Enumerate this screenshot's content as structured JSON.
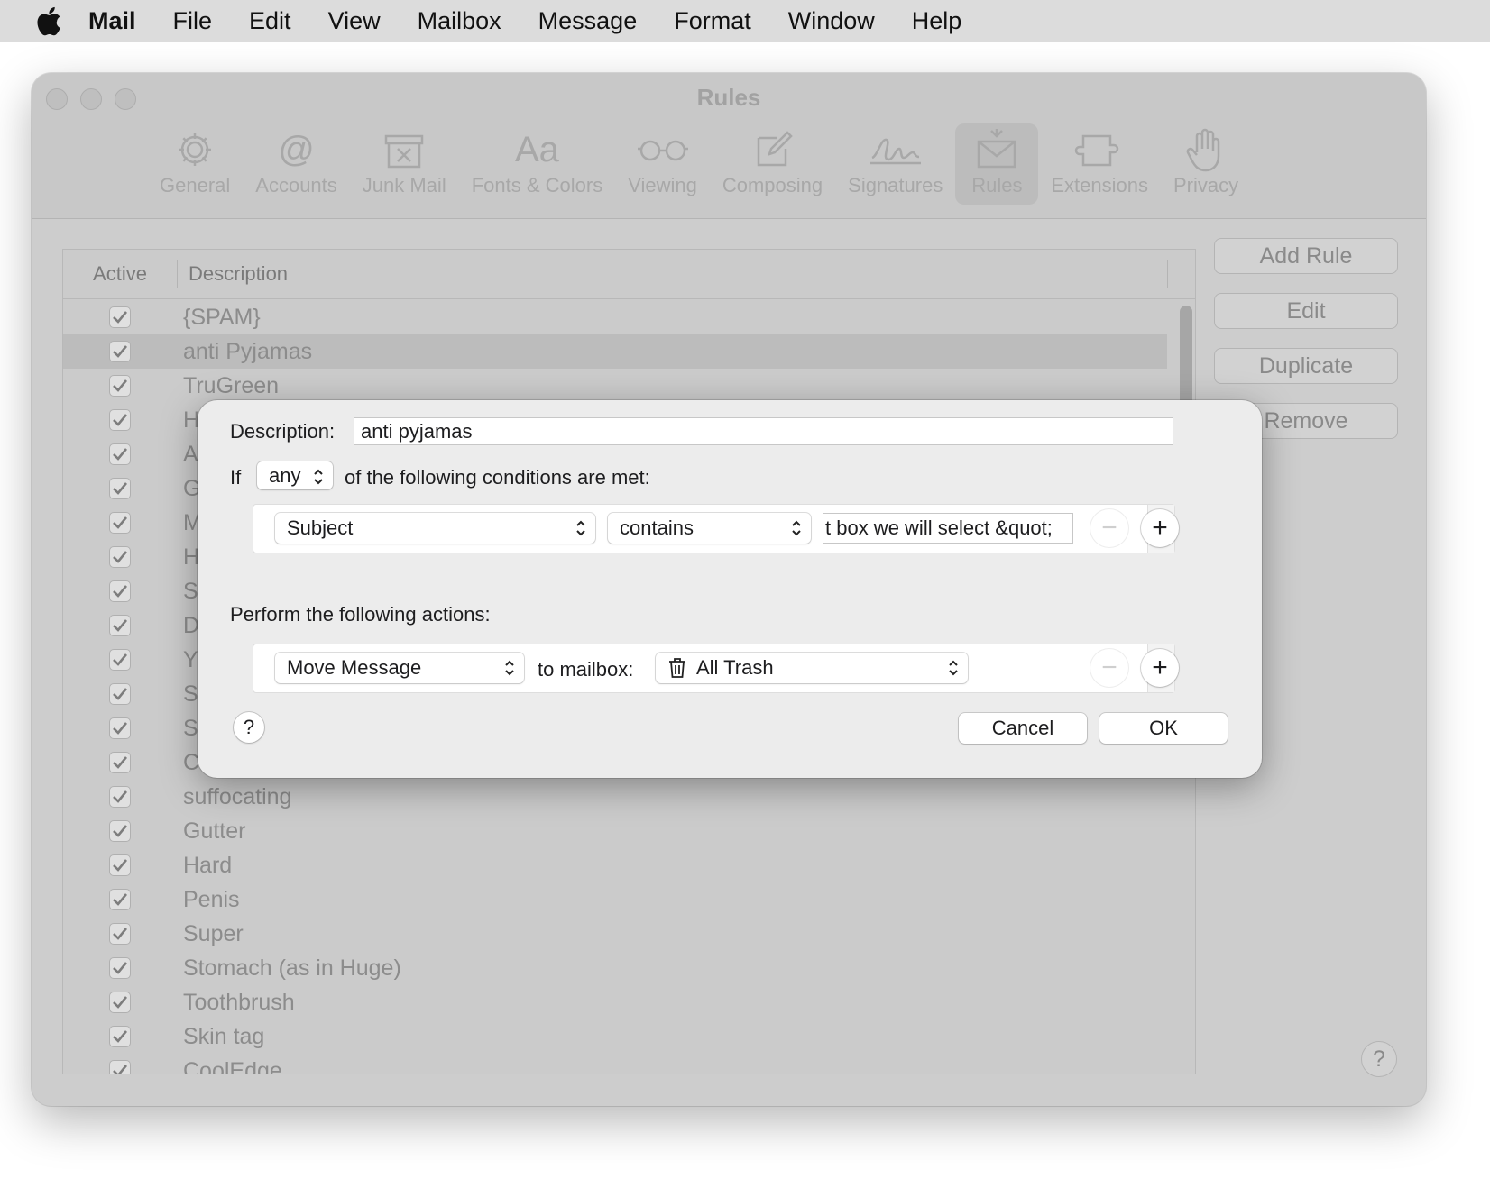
{
  "menubar": {
    "app_name": "Mail",
    "items": [
      "File",
      "Edit",
      "View",
      "Mailbox",
      "Message",
      "Format",
      "Window",
      "Help"
    ]
  },
  "window": {
    "title": "Rules",
    "toolbar": [
      {
        "label": "General",
        "icon": "gear-icon"
      },
      {
        "label": "Accounts",
        "icon": "at-icon"
      },
      {
        "label": "Junk Mail",
        "icon": "junk-mail-icon"
      },
      {
        "label": "Fonts & Colors",
        "icon": "fonts-icon"
      },
      {
        "label": "Viewing",
        "icon": "glasses-icon"
      },
      {
        "label": "Composing",
        "icon": "compose-icon"
      },
      {
        "label": "Signatures",
        "icon": "signature-icon"
      },
      {
        "label": "Rules",
        "icon": "rules-icon",
        "active": true
      },
      {
        "label": "Extensions",
        "icon": "extensions-icon"
      },
      {
        "label": "Privacy",
        "icon": "hand-icon"
      }
    ]
  },
  "rules_table": {
    "headers": {
      "active": "Active",
      "description": "Description"
    },
    "rows": [
      {
        "active": true,
        "description": "{SPAM}"
      },
      {
        "active": true,
        "description": "anti Pyjamas",
        "selected": true
      },
      {
        "active": true,
        "description": "TruGreen"
      },
      {
        "active": true,
        "description": "H"
      },
      {
        "active": true,
        "description": "A"
      },
      {
        "active": true,
        "description": "G"
      },
      {
        "active": true,
        "description": "M"
      },
      {
        "active": true,
        "description": "H"
      },
      {
        "active": true,
        "description": "S"
      },
      {
        "active": true,
        "description": "D"
      },
      {
        "active": true,
        "description": "Y"
      },
      {
        "active": true,
        "description": "S"
      },
      {
        "active": true,
        "description": "S"
      },
      {
        "active": true,
        "description": "C"
      },
      {
        "active": true,
        "description": "suffocating"
      },
      {
        "active": true,
        "description": "Gutter"
      },
      {
        "active": true,
        "description": "Hard"
      },
      {
        "active": true,
        "description": "Penis"
      },
      {
        "active": true,
        "description": "Super"
      },
      {
        "active": true,
        "description": "Stomach (as in Huge)"
      },
      {
        "active": true,
        "description": "Toothbrush"
      },
      {
        "active": true,
        "description": "Skin tag"
      },
      {
        "active": true,
        "description": "CoolEdge"
      }
    ]
  },
  "side_buttons": {
    "add_rule": "Add Rule",
    "edit": "Edit",
    "duplicate": "Duplicate",
    "remove": "Remove",
    "help": "?"
  },
  "sheet": {
    "description_label": "Description:",
    "description_value": "anti pyjamas",
    "if_label": "If",
    "match_mode": "any",
    "conditions_text": "of the following conditions are met:",
    "condition": {
      "field": "Subject",
      "operator": "contains",
      "value": "t box we will select &quot;"
    },
    "actions_label": "Perform the following actions:",
    "action": {
      "type": "Move Message",
      "to_label": "to mailbox:",
      "mailbox": "All Trash",
      "mailbox_icon": "trash-icon"
    },
    "minus": "−",
    "plus": "+",
    "help": "?",
    "cancel": "Cancel",
    "ok": "OK"
  }
}
